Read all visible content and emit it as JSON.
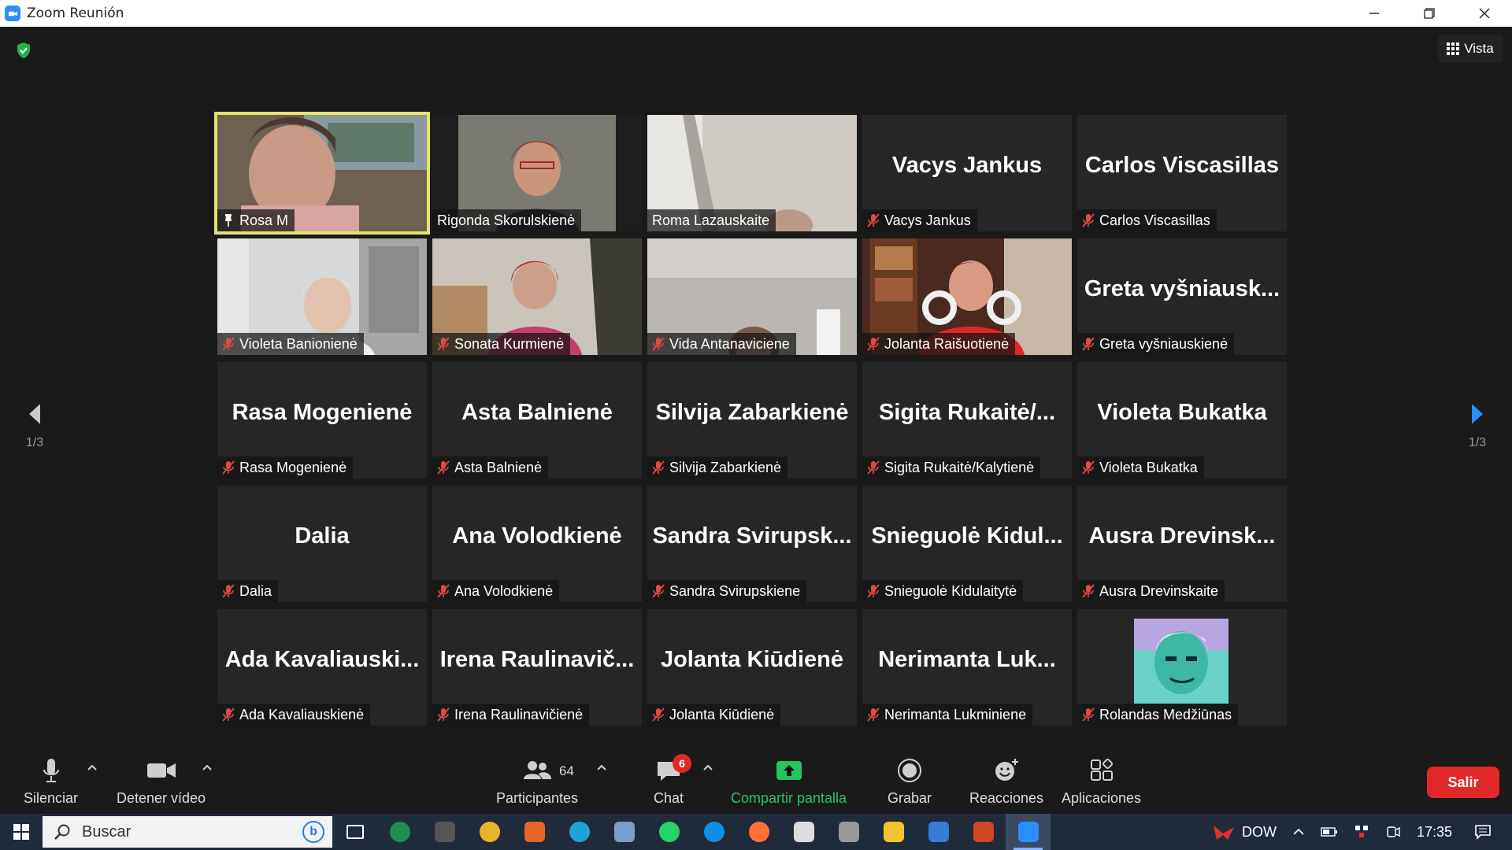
{
  "window": {
    "title": "Zoom Reunión",
    "minimize": "minimize-icon",
    "restore": "restore-icon",
    "close": "close-icon"
  },
  "header": {
    "security_icon": "shield-check-icon",
    "view_label": "Vista"
  },
  "pagination": {
    "left": "1/3",
    "right": "1/3"
  },
  "participants_grid": [
    {
      "big": "",
      "label": "Rosa M",
      "icon": "pin-icon",
      "video": true,
      "active": true
    },
    {
      "big": "",
      "label": "Rigonda Skorulskienė",
      "icon": "",
      "video": true
    },
    {
      "big": "",
      "label": "Roma Lazauskaite",
      "icon": "",
      "video": true
    },
    {
      "big": "Vacys Jankus",
      "label": "Vacys Jankus",
      "icon": "mic-muted-icon"
    },
    {
      "big": "Carlos Viscasillas",
      "label": "Carlos Viscasillas",
      "icon": "mic-muted-icon"
    },
    {
      "big": "",
      "label": "Violeta Banionienė",
      "icon": "mic-muted-icon",
      "video": true
    },
    {
      "big": "",
      "label": "Sonata Kurmienė",
      "icon": "mic-muted-icon",
      "video": true
    },
    {
      "big": "",
      "label": "Vida Antanaviciene",
      "icon": "mic-muted-icon",
      "video": true
    },
    {
      "big": "",
      "label": "Jolanta Raišuotienė",
      "icon": "mic-muted-icon",
      "video": true
    },
    {
      "big": "Greta  vyšniausk...",
      "label": "Greta vyšniauskienė",
      "icon": "mic-muted-icon"
    },
    {
      "big": "Rasa Mogenienė",
      "label": "Rasa Mogenienė",
      "icon": "mic-muted-icon"
    },
    {
      "big": "Asta Balnienė",
      "label": "Asta Balnienė",
      "icon": "mic-muted-icon"
    },
    {
      "big": "Silvija Zabarkienė",
      "label": "Silvija Zabarkienė",
      "icon": "mic-muted-icon"
    },
    {
      "big": "Sigita  Rukaitė/...",
      "label": "Sigita Rukaitė/Kalytienė",
      "icon": "mic-muted-icon"
    },
    {
      "big": "Violeta Bukatka",
      "label": "Violeta Bukatka",
      "icon": "mic-muted-icon"
    },
    {
      "big": "Dalia",
      "label": "Dalia",
      "icon": "mic-muted-icon"
    },
    {
      "big": "Ana Volodkienė",
      "label": "Ana Volodkienė",
      "icon": "mic-muted-icon"
    },
    {
      "big": "Sandra  Svirupsk...",
      "label": "Sandra Svirupskiene",
      "icon": "mic-muted-icon"
    },
    {
      "big": "Snieguolė  Kidul...",
      "label": "Snieguolė Kidulaitytė",
      "icon": "mic-muted-icon"
    },
    {
      "big": "Ausra  Drevinsk...",
      "label": "Ausra Drevinskaite",
      "icon": "mic-muted-icon"
    },
    {
      "big": "Ada  Kavaliauski...",
      "label": "Ada Kavaliauskienė",
      "icon": "mic-muted-icon"
    },
    {
      "big": "Irena  Raulinavič...",
      "label": "Irena Raulinavičienė",
      "icon": "mic-muted-icon"
    },
    {
      "big": "Jolanta Kiūdienė",
      "label": "Jolanta Kiūdienė",
      "icon": "mic-muted-icon"
    },
    {
      "big": "Nerimanta  Luk...",
      "label": "Nerimanta Lukminiene",
      "icon": "mic-muted-icon"
    },
    {
      "big": "",
      "label": "Rolandas Medžiūnas",
      "icon": "mic-muted-icon",
      "avatar": true
    }
  ],
  "toolbar": {
    "mute_label": "Silenciar",
    "video_label": "Detener vídeo",
    "participants_label": "Participantes",
    "participants_count": "64",
    "chat_label": "Chat",
    "chat_badge": "6",
    "share_label": "Compartir pantalla",
    "record_label": "Grabar",
    "reactions_label": "Reacciones",
    "apps_label": "Aplicaciones",
    "leave_label": "Salir"
  },
  "taskbar": {
    "search_placeholder": "Buscar",
    "tray_text": "DOW",
    "time": "17:35",
    "apps": [
      "task-view-icon",
      "app-green-icon",
      "app-dark-icon",
      "chrome-icon",
      "app-orange-icon",
      "edge-icon",
      "app-scanner-icon",
      "whatsapp-icon",
      "teamviewer-icon",
      "firefox-icon",
      "app-diamond-icon",
      "app-gray-icon",
      "file-explorer-icon",
      "app-blue-icon",
      "powerpoint-icon",
      "zoom-icon"
    ]
  },
  "colors": {
    "accent_green": "#22c55e",
    "leave_red": "#e02828",
    "active_speaker": "#e5e46a",
    "muted_red": "#e04848"
  }
}
